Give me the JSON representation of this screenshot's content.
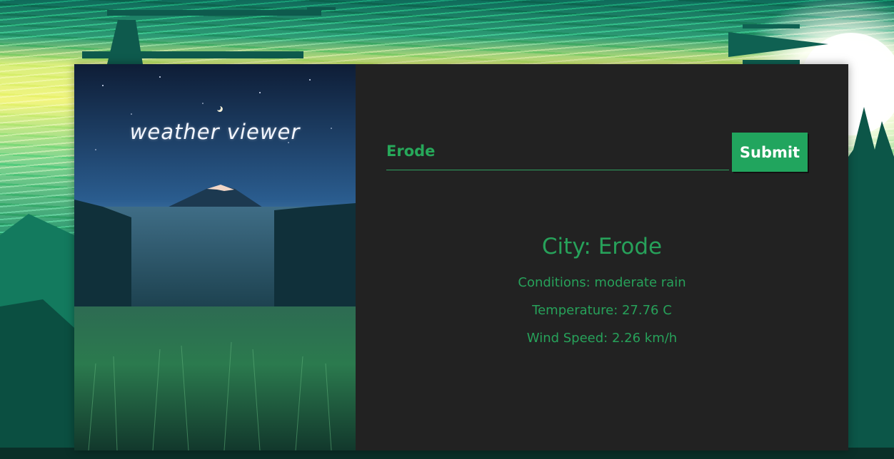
{
  "app": {
    "title": "weather viewer"
  },
  "search": {
    "value": "Erode",
    "placeholder": "",
    "submit_label": "Submit"
  },
  "result": {
    "city": "City: Erode",
    "conditions": "Conditions: moderate rain",
    "temperature": "Temperature: 27.76 C",
    "wind": "Wind Speed: 2.26 km/h"
  },
  "colors": {
    "accent": "#21a55e",
    "text_green": "#27a15a",
    "panel_bg": "#222222"
  }
}
